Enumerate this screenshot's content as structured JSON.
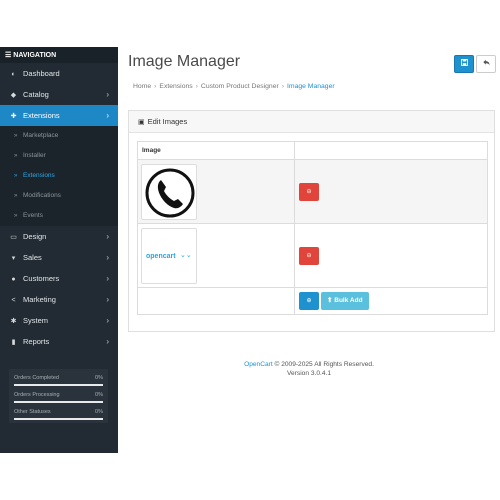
{
  "nav": {
    "header": "NAVIGATION",
    "items": [
      {
        "label": "Dashboard",
        "icon": "dashboard-icon",
        "glyph": "◐",
        "chevron": ""
      },
      {
        "label": "Catalog",
        "icon": "tag-icon",
        "glyph": "◆",
        "chevron": "›"
      },
      {
        "label": "Extensions",
        "icon": "puzzle-icon",
        "glyph": "✚",
        "chevron": "›"
      }
    ],
    "sub_items": [
      {
        "label": "Marketplace"
      },
      {
        "label": "Installer"
      },
      {
        "label": "Extensions"
      },
      {
        "label": "Modifications"
      },
      {
        "label": "Events"
      }
    ],
    "items_after": [
      {
        "label": "Design",
        "icon": "monitor-icon",
        "glyph": "▭",
        "chevron": "›"
      },
      {
        "label": "Sales",
        "icon": "cart-icon",
        "glyph": "▾",
        "chevron": "›"
      },
      {
        "label": "Customers",
        "icon": "user-icon",
        "glyph": "●",
        "chevron": "›"
      },
      {
        "label": "Marketing",
        "icon": "share-icon",
        "glyph": "<",
        "chevron": "›"
      },
      {
        "label": "System",
        "icon": "gear-icon",
        "glyph": "✱",
        "chevron": "›"
      },
      {
        "label": "Reports",
        "icon": "bar-chart-icon",
        "glyph": "▮",
        "chevron": "›"
      }
    ],
    "stats": [
      {
        "label": "Orders Completed",
        "value": "0%",
        "progress": 0
      },
      {
        "label": "Orders Processing",
        "value": "0%",
        "progress": 0
      },
      {
        "label": "Other Statuses",
        "value": "0%",
        "progress": 0
      }
    ]
  },
  "page": {
    "title": "Image Manager",
    "save_icon": "save-icon",
    "back_icon": "reply-icon",
    "breadcrumb": [
      "Home",
      "Extensions",
      "Custom Product Designer",
      "Image Manager"
    ]
  },
  "panel": {
    "heading": "Edit Images",
    "column_image": "Image",
    "rows": [
      {
        "thumb": "phone-icon-image"
      },
      {
        "thumb": "opencart-logo-image",
        "logo_text": "opencart"
      }
    ],
    "bulk_add_label": "Bulk Add"
  },
  "footer": {
    "link": "OpenCart",
    "text": "© 2009-2025 All Rights Reserved.",
    "version": "Version 3.0.4.1"
  },
  "colors": {
    "sidebar_bg": "#222b33",
    "active_blue": "#1e87c6",
    "danger": "#e0443a",
    "info": "#5bc0de"
  }
}
